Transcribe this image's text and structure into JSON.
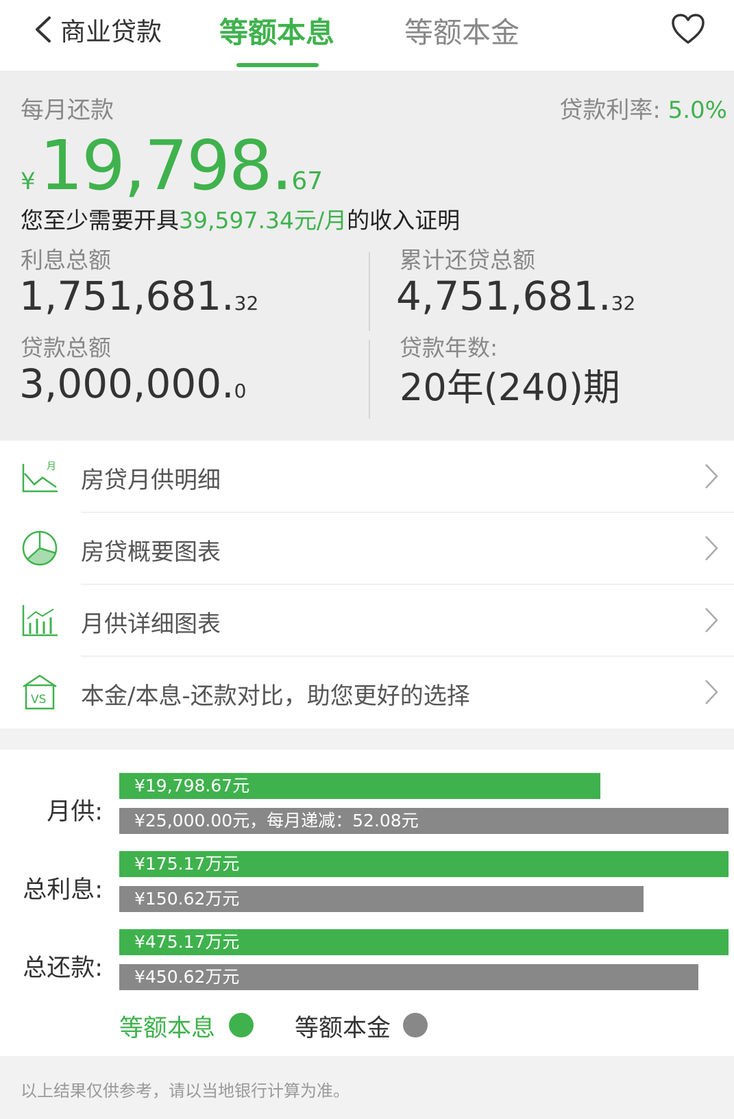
{
  "header": {
    "back_label": "商业贷款",
    "tab_active": "等额本息",
    "tab_inactive": "等额本金",
    "favorite_icon": "heart-icon"
  },
  "summary": {
    "monthly_label": "每月还款",
    "rate_label": "贷款利率: ",
    "rate_value": "5.0%",
    "currency": "¥",
    "monthly_int": "19,798.",
    "monthly_dec": "67",
    "income_prefix": "您至少需要开具",
    "income_value": "39,597.34元/月",
    "income_suffix": "的收入证明",
    "interest_label": "利息总额",
    "interest_int": "1,751,681.",
    "interest_dec": "32",
    "total_repay_label": "累计还贷总额",
    "total_repay_int": "4,751,681.",
    "total_repay_dec": "32",
    "loan_label": "贷款总额",
    "loan_int": "3,000,000.",
    "loan_dec": "0",
    "years_label": "贷款年数:",
    "years_value": "20年(240)期"
  },
  "menu": {
    "items": [
      {
        "label": "房贷月供明细",
        "icon": "line-chart-icon"
      },
      {
        "label": "房贷概要图表",
        "icon": "pie-chart-icon"
      },
      {
        "label": "月供详细图表",
        "icon": "bar-chart-icon"
      },
      {
        "label": "本金/本息-还款对比，助您更好的选择",
        "icon": "vs-house-icon"
      }
    ]
  },
  "compare": {
    "rows": [
      {
        "label": "月供:",
        "green_text": "¥19,798.67元",
        "gray_text": "¥25,000.00元，每月递减：52.08元",
        "green_fraction": 0.79,
        "gray_fraction": 1.0
      },
      {
        "label": "总利息:",
        "green_text": "¥175.17万元",
        "gray_text": "¥150.62万元",
        "green_fraction": 1.0,
        "gray_fraction": 0.86
      },
      {
        "label": "总还款:",
        "green_text": "¥475.17万元",
        "gray_text": "¥450.62万元",
        "green_fraction": 1.0,
        "gray_fraction": 0.95
      }
    ],
    "legend": [
      {
        "label": "等额本息",
        "color": "#3fb24d"
      },
      {
        "label": "等额本金",
        "color": "#888888"
      }
    ]
  },
  "colors": {
    "accent": "#3fb24d",
    "gray_bar": "#888888"
  },
  "footer": {
    "note": "以上结果仅供参考，请以当地银行计算为准。"
  }
}
